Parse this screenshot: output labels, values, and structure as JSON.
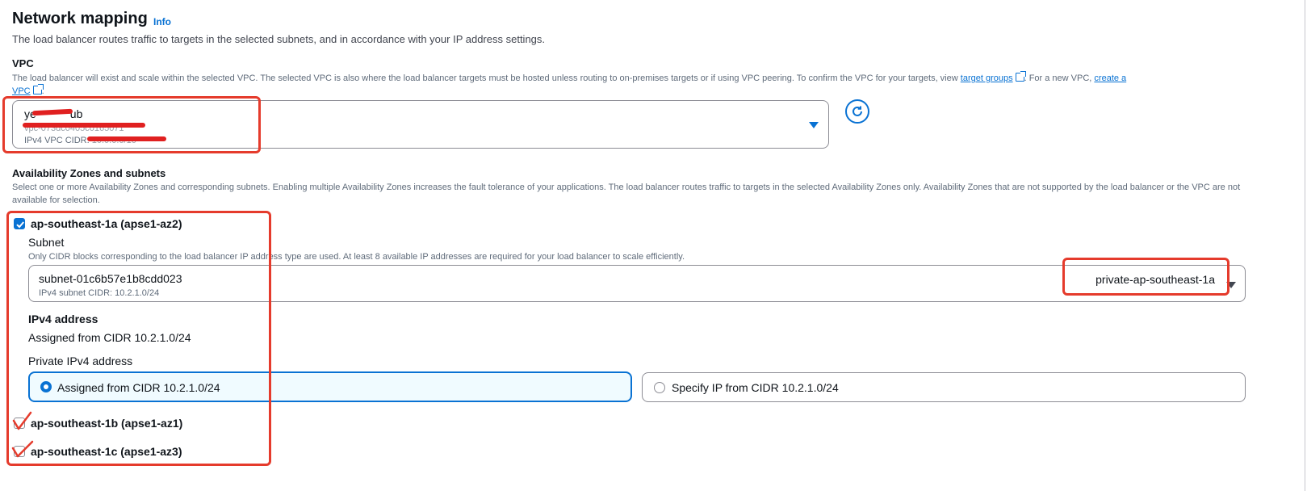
{
  "header": {
    "title": "Network mapping",
    "info_link": "Info",
    "description": "The load balancer routes traffic to targets in the selected subnets, and in accordance with your IP address settings."
  },
  "vpc": {
    "label": "VPC",
    "description_part1": "The load balancer will exist and scale within the selected VPC. The selected VPC is also where the load balancer targets must be hosted unless routing to on-premises targets or if using VPC peering. To confirm the VPC for your targets, view",
    "target_groups_link": "target groups",
    "description_part2": ". For a new VPC,",
    "create_link_a": "create a",
    "create_link_b": "VPC",
    "description_end": ".",
    "selected": {
      "name_visible_start": "ye",
      "name_visible_end": "ub",
      "id_hint": "vpc-073dc0405c0165071",
      "cidr_label": "IPv4 VPC CIDR:",
      "cidr_value": "10.0.0.0/16"
    },
    "refresh_icon": "refresh-icon"
  },
  "az": {
    "label": "Availability Zones and subnets",
    "description": "Select one or more Availability Zones and corresponding subnets. Enabling multiple Availability Zones increases the fault tolerance of your applications. The load balancer routes traffic to targets in the selected Availability Zones only. Availability Zones that are not supported by the load balancer or the VPC are not available for selection.",
    "zones": [
      {
        "name": "ap-southeast-1a (apse1-az2)",
        "checked": true,
        "subnet_label": "Subnet",
        "subnet_hint": "Only CIDR blocks corresponding to the load balancer IP address type are used. At least 8 available IP addresses are required for your load balancer to scale efficiently.",
        "subnet_id": "subnet-01c6b57e1b8cdd023",
        "subnet_cidr": "IPv4 subnet CIDR: 10.2.1.0/24",
        "subnet_name": "private-ap-southeast-1a",
        "ipv4_label": "IPv4 address",
        "ipv4_assigned": "Assigned from CIDR 10.2.1.0/24",
        "private_ipv4_label": "Private IPv4 address",
        "option_assigned": "Assigned from CIDR 10.2.1.0/24",
        "option_specify": "Specify IP from CIDR 10.2.1.0/24"
      },
      {
        "name": "ap-southeast-1b (apse1-az1)",
        "checked": false
      },
      {
        "name": "ap-southeast-1c (apse1-az3)",
        "checked": false
      }
    ]
  },
  "colors": {
    "accent": "#0972d3",
    "annotation_red": "#e53b2c",
    "selected_tile_bg": "#f0fbff"
  }
}
